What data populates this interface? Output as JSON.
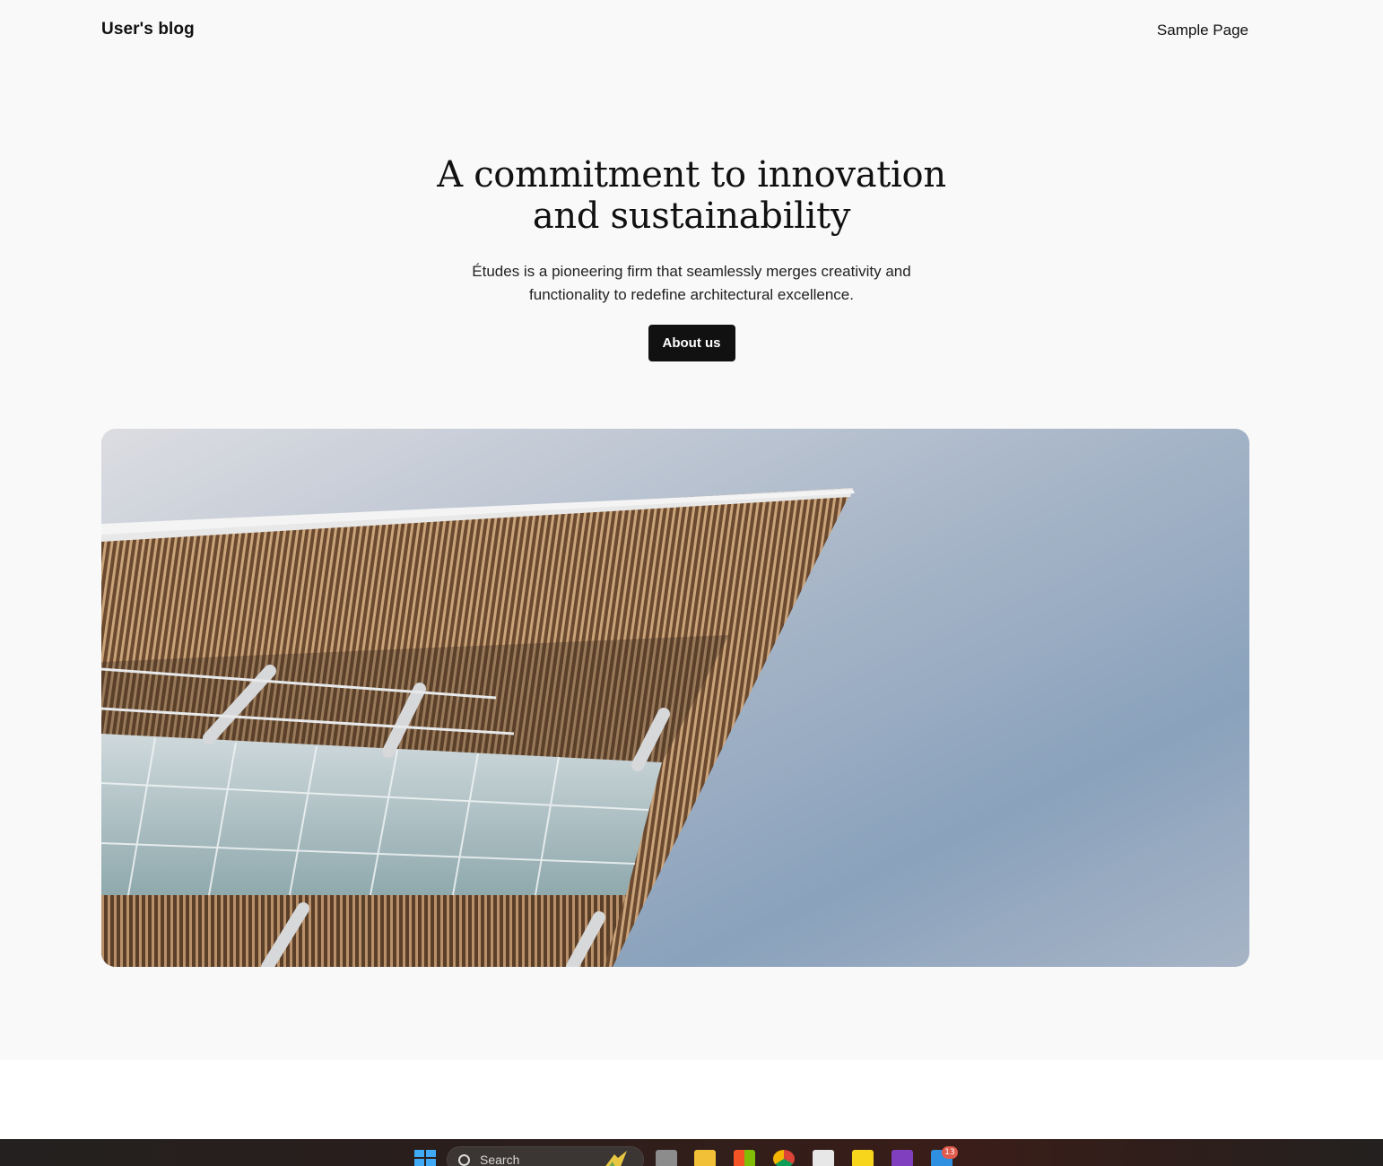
{
  "header": {
    "site_title": "User's blog",
    "nav": [
      {
        "label": "Sample Page"
      }
    ]
  },
  "hero": {
    "heading": "A commitment to innovation and sustainability",
    "description": "Études is a pioneering firm that seamlessly merges creativity and functionality to redefine architectural excellence.",
    "button_label": "About us"
  },
  "image": {
    "subject": "building-roof-against-sky"
  },
  "taskbar": {
    "search_placeholder": "Search",
    "icons": [
      "windows-start-icon",
      "task-view-icon",
      "file-explorer-icon",
      "microsoft-store-icon",
      "chrome-icon",
      "snipping-tool-icon",
      "sticky-notes-icon",
      "onenote-icon",
      "mail-icon"
    ],
    "mail_badge": "13"
  },
  "colors": {
    "page_background": "#f9f9f9",
    "button_background": "#111111",
    "button_text": "#ffffff",
    "taskbar_background": "#2a1e1c",
    "badge": "#e05b4e"
  }
}
